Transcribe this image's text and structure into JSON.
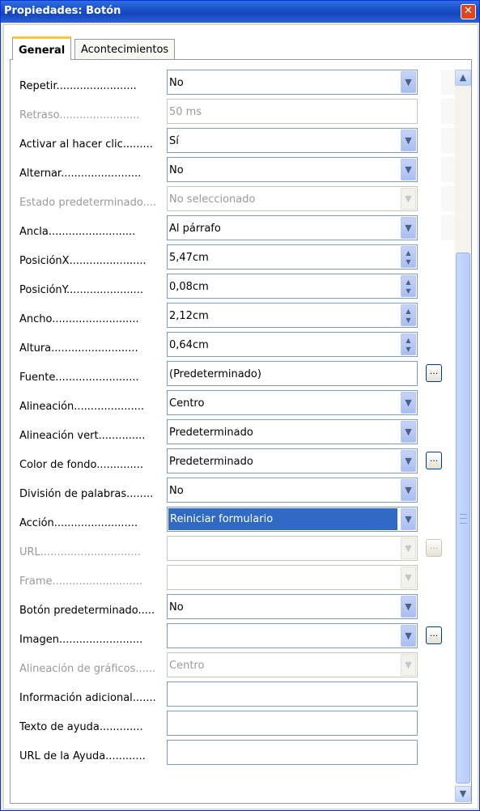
{
  "window": {
    "title": "Propiedades: Botón",
    "close_icon": "close-icon"
  },
  "tabs": [
    {
      "label": "General",
      "active": true
    },
    {
      "label": "Acontecimientos",
      "active": false
    }
  ],
  "rows": [
    {
      "label": "Repetir........................",
      "value": "No",
      "control": "dropdown",
      "disabled": false
    },
    {
      "label": "Retraso........................",
      "value": "50 ms",
      "control": "text",
      "disabled": true
    },
    {
      "label": "Activar al hacer clic.........",
      "value": "Sí",
      "control": "dropdown",
      "disabled": false
    },
    {
      "label": "Alternar........................",
      "value": "No",
      "control": "dropdown",
      "disabled": false
    },
    {
      "label": "Estado predeterminado....",
      "value": "No seleccionado",
      "control": "dropdown",
      "disabled": true
    },
    {
      "label": "Ancla..........................",
      "value": "Al párrafo",
      "control": "dropdown",
      "disabled": false
    },
    {
      "label": "PosiciónX.......................",
      "value": "5,47cm",
      "control": "spin",
      "disabled": false
    },
    {
      "label": "PosiciónY.......................",
      "value": "0,08cm",
      "control": "spin",
      "disabled": false
    },
    {
      "label": "Ancho..........................",
      "value": "2,12cm",
      "control": "spin",
      "disabled": false
    },
    {
      "label": "Altura..........................",
      "value": "0,64cm",
      "control": "spin",
      "disabled": false
    },
    {
      "label": "Fuente.........................",
      "value": "(Predeterminado)",
      "control": "text",
      "disabled": false,
      "ellipsis": true
    },
    {
      "label": "Alineación.....................",
      "value": "Centro",
      "control": "dropdown",
      "disabled": false
    },
    {
      "label": "Alineación vert..............",
      "value": "Predeterminado",
      "control": "dropdown",
      "disabled": false
    },
    {
      "label": "Color de fondo..............",
      "value": "Predeterminado",
      "control": "dropdown",
      "disabled": false,
      "ellipsis": true
    },
    {
      "label": "División de palabras........",
      "value": "No",
      "control": "dropdown",
      "disabled": false
    },
    {
      "label": "Acción.........................",
      "value": "Reiniciar formulario",
      "control": "dropdown",
      "disabled": false,
      "selected": true
    },
    {
      "label": "URL..............................",
      "value": "",
      "control": "dropdown",
      "disabled": true,
      "ellipsis": true
    },
    {
      "label": "Frame...........................",
      "value": "",
      "control": "dropdown",
      "disabled": true
    },
    {
      "label": "Botón predeterminado.....",
      "value": "No",
      "control": "dropdown",
      "disabled": false
    },
    {
      "label": "Imagen.........................",
      "value": "",
      "control": "dropdown",
      "disabled": false,
      "ellipsis": true
    },
    {
      "label": "Alineación de gráficos......",
      "value": "Centro",
      "control": "dropdown",
      "disabled": true
    },
    {
      "label": "Información adicional.......",
      "value": "",
      "control": "text",
      "disabled": false
    },
    {
      "label": "Texto de ayuda.............",
      "value": "",
      "control": "text",
      "disabled": false
    },
    {
      "label": "URL de la Ayuda............",
      "value": "",
      "control": "text",
      "disabled": false
    }
  ],
  "icons": {
    "dropdown": "chevron-down-icon",
    "spin": "spin-arrows-icon",
    "ellipsis": "ellipsis-button-icon",
    "scroll_up": "scroll-up-icon",
    "scroll_down": "scroll-down-icon"
  },
  "glyphs": {
    "ellipsis": "...",
    "close": "✕",
    "down": "▼",
    "up": "▲",
    "spin_up": "▲",
    "spin_down": "▼"
  }
}
